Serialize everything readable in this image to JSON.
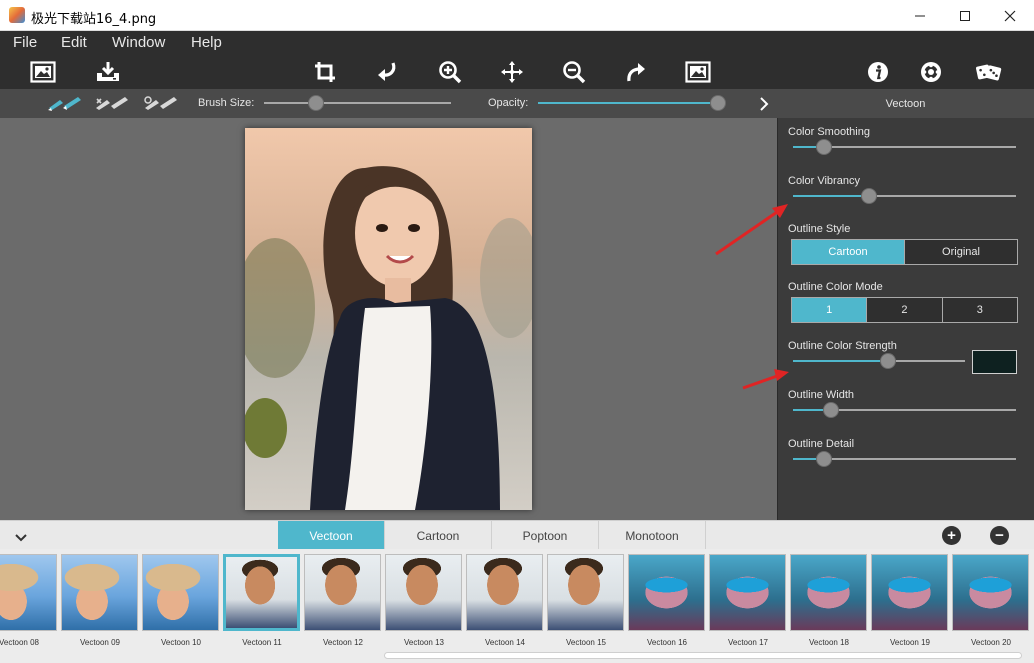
{
  "window": {
    "title": "极光下载站16_4.png",
    "minimize_icon": "minimize-icon",
    "maximize_icon": "maximize-icon",
    "close_icon": "close-icon"
  },
  "menu": [
    "File",
    "Edit",
    "Window",
    "Help"
  ],
  "toolbar": {
    "left": [
      "open-image-icon",
      "save-icon"
    ],
    "center": [
      "crop-icon",
      "undo-icon",
      "zoom-in-icon",
      "move-icon",
      "zoom-out-icon",
      "redo-icon",
      "fit-image-icon"
    ],
    "right": [
      "info-icon",
      "settings-icon",
      "dice-icon"
    ]
  },
  "subbar": {
    "brush_tools": [
      "brush-icon",
      "brush-erase-icon",
      "brush-restore-icon"
    ],
    "brush_size_label": "Brush Size:",
    "brush_size_value": 0.28,
    "opacity_label": "Opacity:",
    "opacity_value": 1.0,
    "next_icon": "chevron-right-icon"
  },
  "panel": {
    "title": "Vectoon",
    "color_smoothing": {
      "label": "Color Smoothing",
      "value": 0.14
    },
    "color_vibrancy": {
      "label": "Color Vibrancy",
      "value": 0.34
    },
    "outline_style": {
      "label": "Outline Style",
      "options": [
        "Cartoon",
        "Original"
      ],
      "selected": "Cartoon"
    },
    "outline_color_mode": {
      "label": "Outline Color Mode",
      "options": [
        "1",
        "2",
        "3"
      ],
      "selected": "1"
    },
    "outline_color_strength": {
      "label": "Outline Color Strength",
      "value": 0.55,
      "swatch_color": "#0e2120"
    },
    "outline_width": {
      "label": "Outline Width",
      "value": 0.17
    },
    "outline_detail": {
      "label": "Outline Detail",
      "value": 0.14
    }
  },
  "tabs": {
    "collapse_icon": "chevron-down-icon",
    "items": [
      "Vectoon",
      "Cartoon",
      "Poptoon",
      "Monotoon"
    ],
    "selected": "Vectoon",
    "add_icon": "plus-icon",
    "remove_icon": "minus-icon"
  },
  "thumbnails": [
    {
      "label": "Vectoon 08",
      "style": "hat"
    },
    {
      "label": "Vectoon 09",
      "style": "hat"
    },
    {
      "label": "Vectoon 10",
      "style": "hat"
    },
    {
      "label": "Vectoon 11",
      "style": "man"
    },
    {
      "label": "Vectoon 12",
      "style": "man"
    },
    {
      "label": "Vectoon 13",
      "style": "man"
    },
    {
      "label": "Vectoon 14",
      "style": "man"
    },
    {
      "label": "Vectoon 15",
      "style": "man"
    },
    {
      "label": "Vectoon 16",
      "style": "goggle"
    },
    {
      "label": "Vectoon 17",
      "style": "goggle"
    },
    {
      "label": "Vectoon 18",
      "style": "goggle"
    },
    {
      "label": "Vectoon 19",
      "style": "goggle"
    },
    {
      "label": "Vectoon 20",
      "style": "goggle"
    }
  ],
  "selected_thumbnail": "Vectoon 11",
  "colors": {
    "accent": "#4fb7cc",
    "annotation_arrow": "#e02424"
  }
}
